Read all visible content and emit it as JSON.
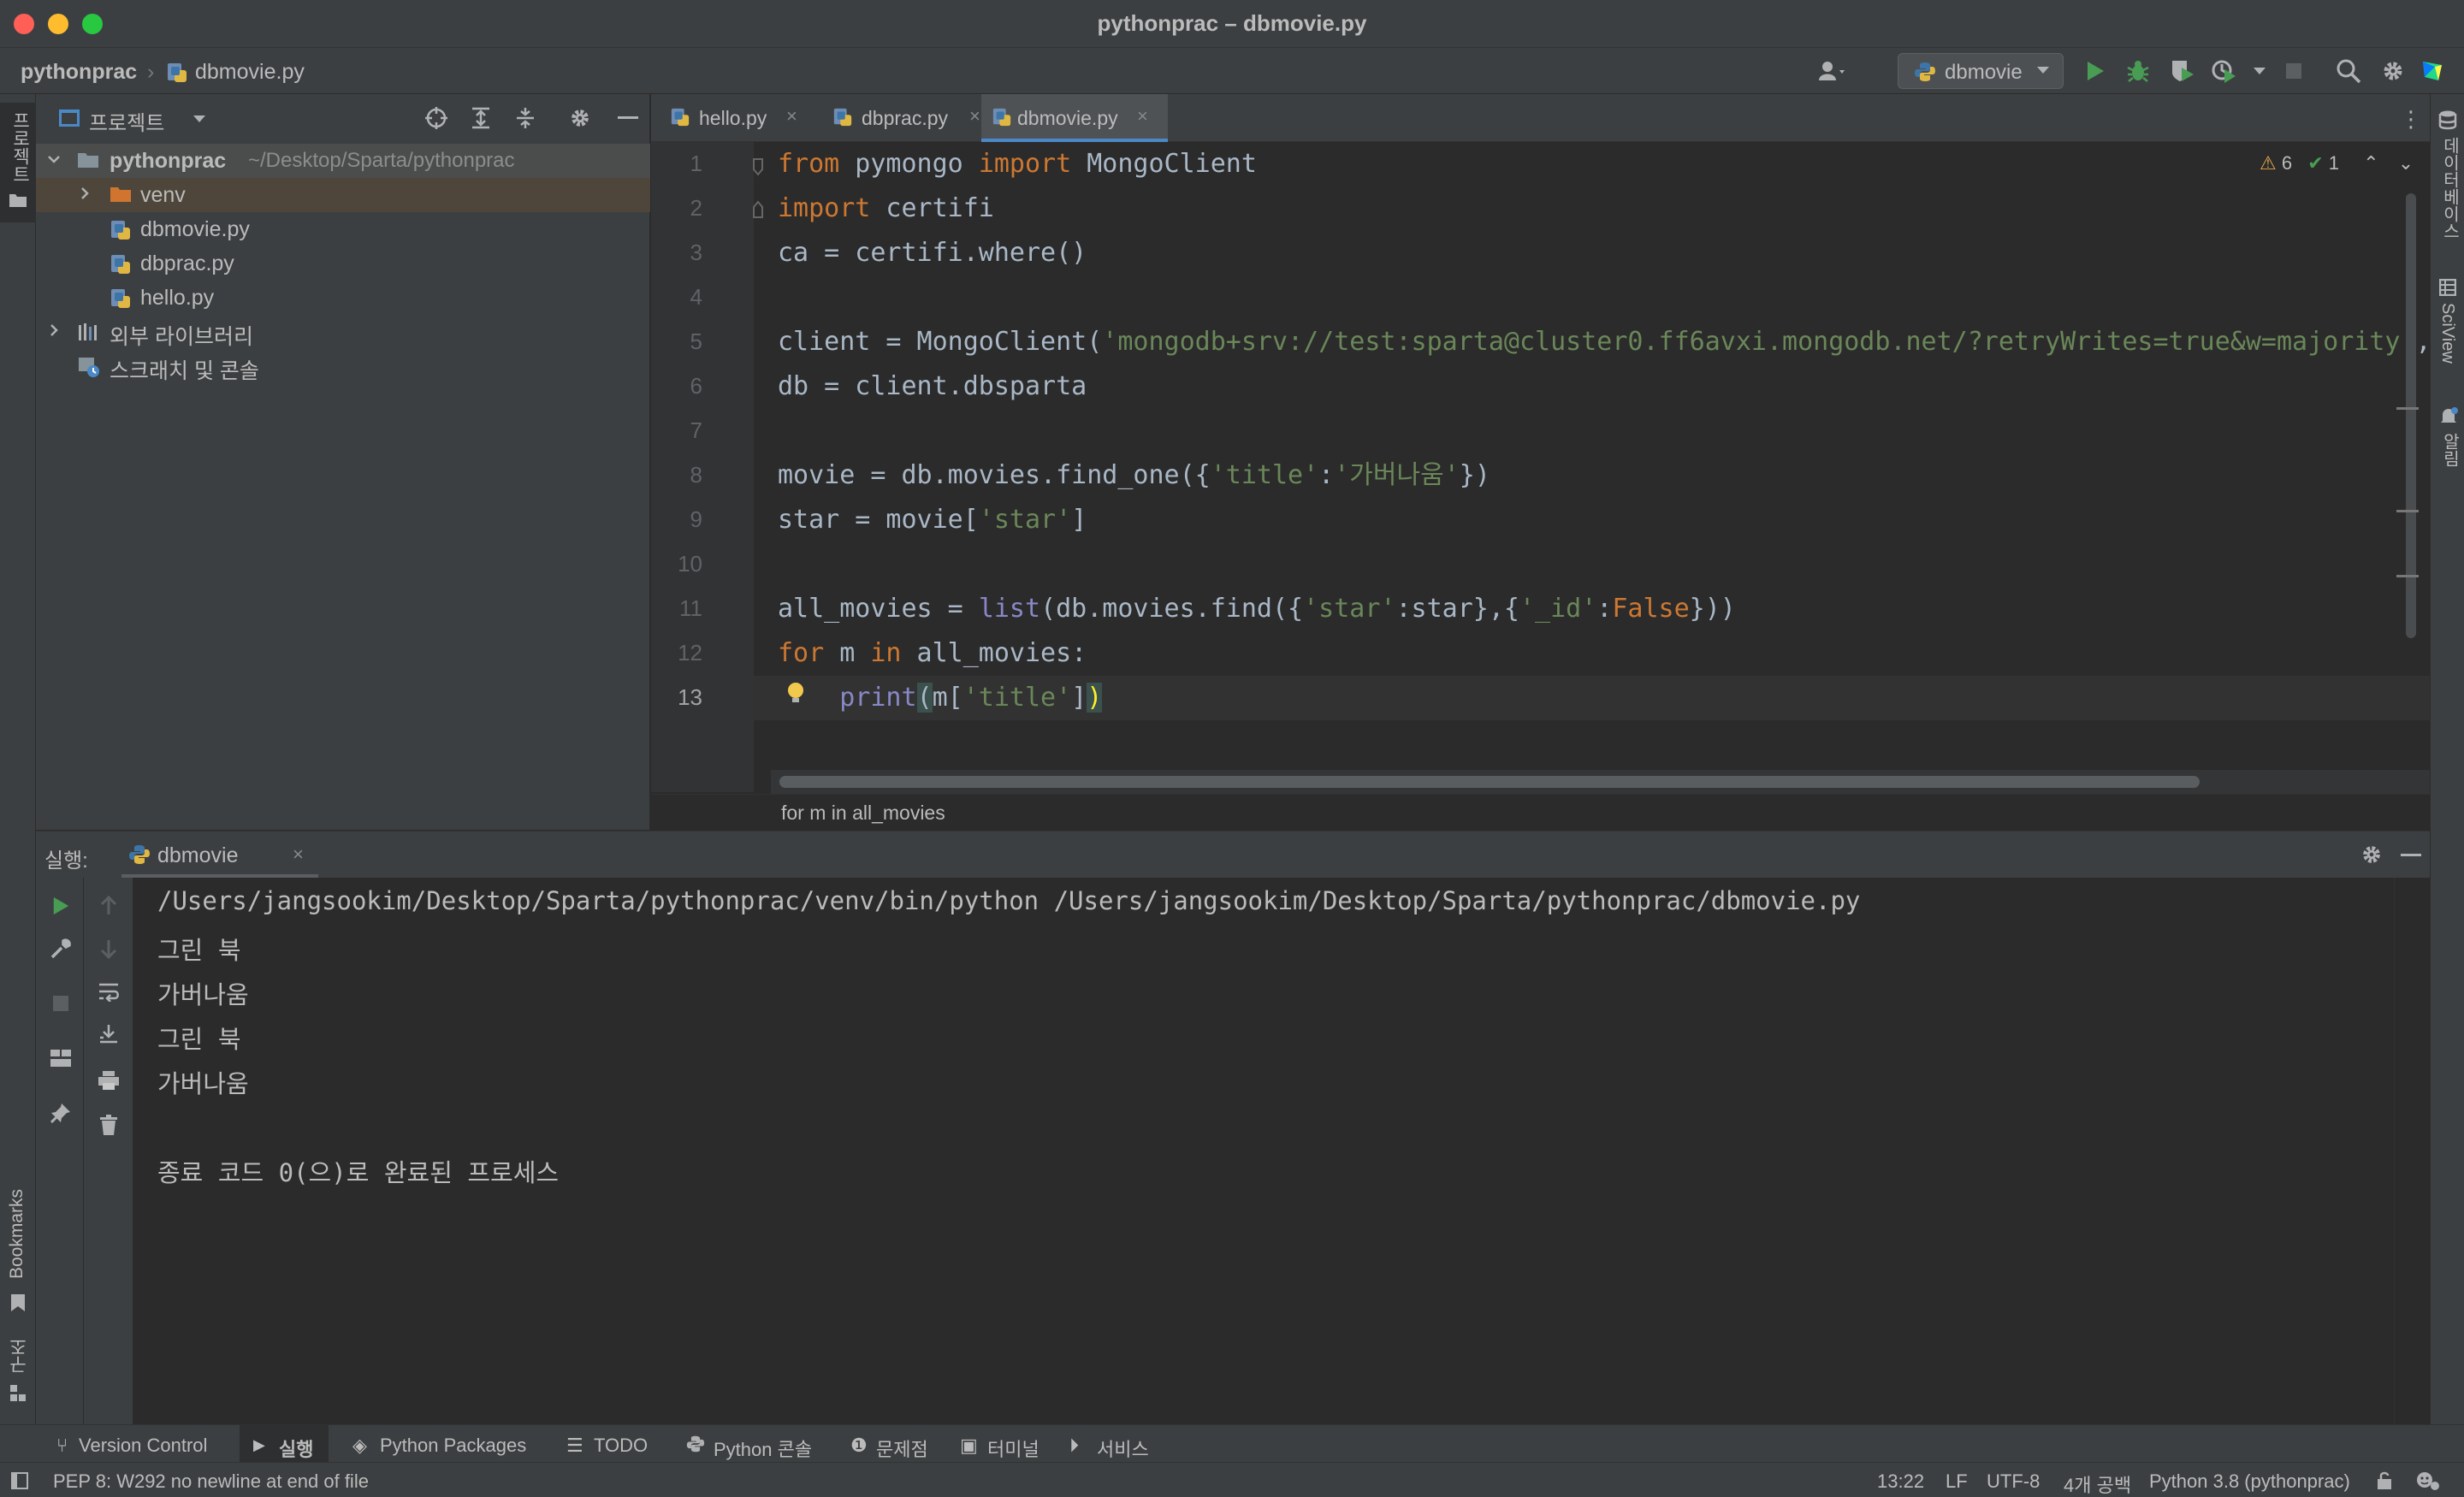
{
  "window": {
    "title": "pythonprac – dbmovie.py",
    "colors": {
      "close": "#ff5f57",
      "minimize": "#febc2e",
      "zoom": "#28c840"
    }
  },
  "navbar": {
    "project": "pythonprac",
    "file": "dbmovie.py",
    "run_config": "dbmovie",
    "icons": [
      "user-icon",
      "run-icon",
      "debug-icon",
      "coverage-icon",
      "profile-icon",
      "stop-icon",
      "search-icon",
      "settings-icon",
      "jetbrains-logo-icon"
    ]
  },
  "left_stripe": {
    "project": "프로젝트",
    "bookmarks": "Bookmarks",
    "structure": "구조"
  },
  "right_stripe": {
    "database": "데이터베이스",
    "sciview": "SciView",
    "notifications": "알림"
  },
  "project_panel": {
    "title": "프로젝트",
    "tree": {
      "root_name": "pythonprac",
      "root_path": "~/Desktop/Sparta/pythonprac",
      "venv": "venv",
      "files": [
        "dbmovie.py",
        "dbprac.py",
        "hello.py"
      ],
      "external_libs": "외부 라이브러리",
      "scratches": "스크래치 및 콘솔"
    }
  },
  "editor": {
    "tabs": [
      {
        "label": "hello.py",
        "active": false
      },
      {
        "label": "dbprac.py",
        "active": false
      },
      {
        "label": "dbmovie.py",
        "active": true
      }
    ],
    "inspection": {
      "warnings": "6",
      "ok": "1"
    },
    "line_numbers": [
      "1",
      "2",
      "3",
      "4",
      "5",
      "6",
      "7",
      "8",
      "9",
      "10",
      "11",
      "12",
      "13"
    ],
    "breadcrumb": "for m in all_movies",
    "code_colors": {
      "keyword": "#cc7832",
      "string": "#6a8759",
      "builtin": "#8888c6",
      "text": "#a9b7c6"
    }
  },
  "run_panel": {
    "label": "실행:",
    "tab": "dbmovie",
    "console": [
      "/Users/jangsookim/Desktop/Sparta/pythonprac/venv/bin/python /Users/jangsookim/Desktop/Sparta/pythonprac/dbmovie.py",
      "그린 북",
      "가버나움",
      "그린 북",
      "가버나움",
      "",
      "종료 코드 0(으)로 완료된 프로세스"
    ]
  },
  "tool_tabs": [
    "Version Control",
    "실행",
    "Python Packages",
    "TODO",
    "Python 콘솔",
    "문제점",
    "터미널",
    "서비스"
  ],
  "status_bar": {
    "message": "PEP 8: W292 no newline at end of file",
    "position": "13:22",
    "line_sep": "LF",
    "encoding": "UTF-8",
    "indent": "4개 공백",
    "interpreter": "Python 3.8 (pythonprac)"
  }
}
